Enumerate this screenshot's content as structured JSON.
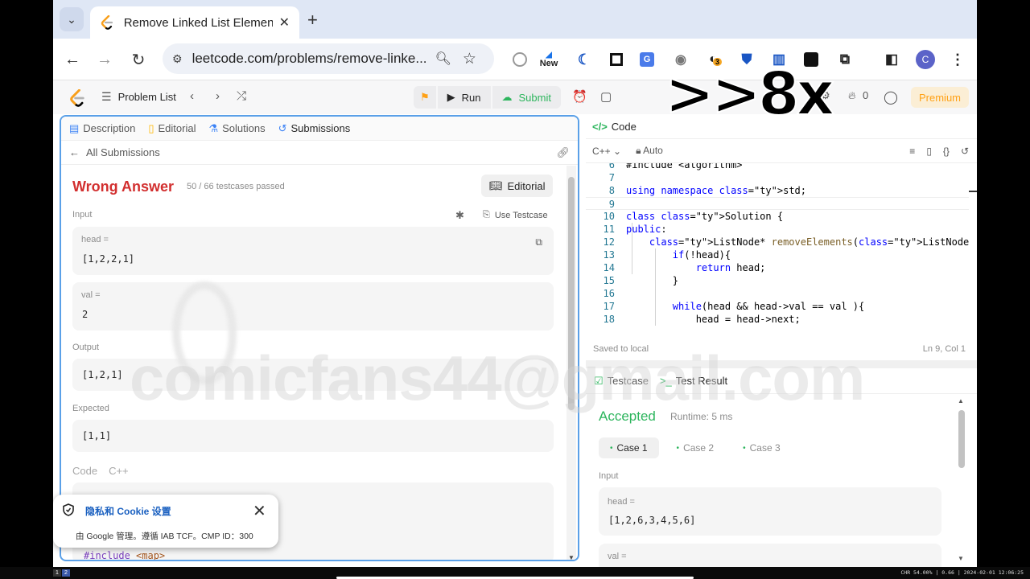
{
  "browser": {
    "tab_title": "Remove Linked List Elemen",
    "url": "leetcode.com/problems/remove-linke...",
    "extension_new_label": "New",
    "extension_badge": "3",
    "profile_initial": "C"
  },
  "header": {
    "problem_list": "Problem List",
    "run": "Run",
    "submit": "Submit",
    "streak_count": "0",
    "premium": "Premium",
    "speed_overlay": ">>8x"
  },
  "left_panel": {
    "tabs": [
      "Description",
      "Editorial",
      "Solutions",
      "Submissions"
    ],
    "back_label": "All Submissions",
    "verdict": "Wrong Answer",
    "testcases_passed": "50 / 66 testcases passed",
    "editorial_button": "Editorial",
    "input_label": "Input",
    "use_testcase": "Use Testcase",
    "inputs": [
      {
        "name": "head =",
        "value": "[1,2,2,1]"
      },
      {
        "name": "val =",
        "value": "2"
      }
    ],
    "output_label": "Output",
    "output_value": "[1,2,1]",
    "expected_label": "Expected",
    "expected_value": "[1,1]",
    "code_label": "Code",
    "code_lang": "C++",
    "code_line_keyword": "#include",
    "code_line_header": "<map>"
  },
  "cookie_popup": {
    "title": "隐私和 Cookie 设置",
    "subtitle": "由 Google 管理。遵循 IAB TCF。CMP ID：300"
  },
  "code_panel": {
    "tab_label": "Code",
    "language": "C++",
    "mode": "Auto",
    "lines": [
      {
        "n": "6",
        "text": "#include <algorithm>"
      },
      {
        "n": "7",
        "text": ""
      },
      {
        "n": "8",
        "text": "using namespace std;"
      },
      {
        "n": "9",
        "text": ""
      },
      {
        "n": "10",
        "text": "class Solution {"
      },
      {
        "n": "11",
        "text": "public:"
      },
      {
        "n": "12",
        "text": "    ListNode* removeElements(ListNode* head, int val) {"
      },
      {
        "n": "13",
        "text": "        if(!head){"
      },
      {
        "n": "14",
        "text": "            return head;"
      },
      {
        "n": "15",
        "text": "        }"
      },
      {
        "n": "16",
        "text": ""
      },
      {
        "n": "17",
        "text": "        while(head && head->val == val ){"
      },
      {
        "n": "18",
        "text": "            head = head->next;"
      }
    ],
    "saved_status": "Saved to local",
    "cursor_position": "Ln 9, Col 1"
  },
  "test_panel": {
    "tabs": [
      "Testcase",
      "Test Result"
    ],
    "result": "Accepted",
    "runtime": "Runtime: 5 ms",
    "cases": [
      "Case 1",
      "Case 2",
      "Case 3"
    ],
    "input_label": "Input",
    "inputs": [
      {
        "name": "head =",
        "value": "[1,2,6,3,4,5,6]"
      },
      {
        "name": "val =",
        "value": ""
      }
    ]
  },
  "watermark": "comicfans44@gmail.com",
  "taskbar": {
    "workspaces": [
      "1",
      "2"
    ],
    "status": "CHR 54.00% | 0.66 | 2024-02-01 12:06:25"
  },
  "colors": {
    "wrong": "#d22f2f",
    "accepted": "#2db55d",
    "premium": "#ffa116",
    "panel_focus": "#5aa0e8"
  }
}
